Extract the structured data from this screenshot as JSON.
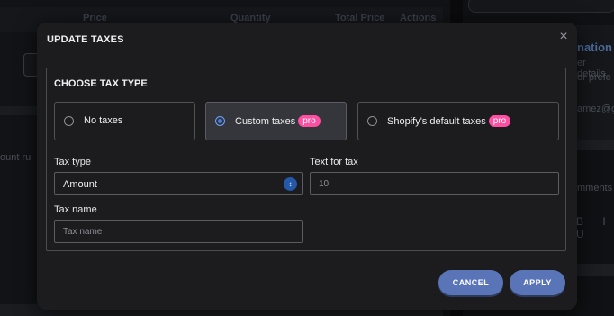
{
  "background": {
    "table_columns": [
      "Price",
      "Quantity",
      "Total Price",
      "Actions"
    ],
    "discount_text": "ount ru",
    "right_panel": {
      "heading": "nation",
      "lines": [
        "er details",
        "or prefe",
        "amez@g",
        "mments"
      ],
      "toolbar_glyphs": "B I U"
    }
  },
  "modal": {
    "title": "UPDATE TAXES",
    "close_glyph": "×",
    "panel_heading": "CHOOSE TAX TYPE",
    "options": [
      {
        "label": "No taxes",
        "pro": "",
        "selected": false
      },
      {
        "label": "Custom taxes",
        "pro": "pro",
        "selected": true
      },
      {
        "label": "Shopify's default taxes",
        "pro": "pro",
        "selected": false
      }
    ],
    "tax_type": {
      "label": "Tax type",
      "value": "Amount",
      "arrow_glyph": "↕"
    },
    "text_for_tax": {
      "label": "Text for tax",
      "placeholder": "10"
    },
    "tax_name": {
      "label": "Tax name",
      "placeholder": "Tax name"
    },
    "buttons": {
      "cancel": "CANCEL",
      "apply": "APPLY"
    }
  },
  "colors": {
    "accent_button": "#5a74b8",
    "pro_badge": "#ff4fa3",
    "radio_checked": "#3d7eea",
    "modal_bg": "#1c1c1f"
  }
}
